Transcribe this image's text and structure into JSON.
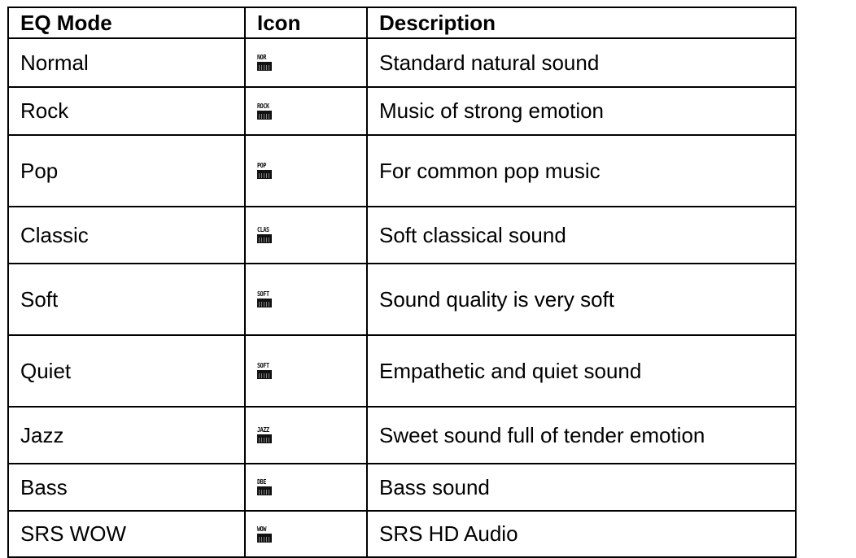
{
  "table": {
    "headers": [
      "EQ Mode",
      "Icon",
      "Description"
    ],
    "rows": [
      {
        "mode": "Normal",
        "icon_text": "NOR",
        "icon": "eq-normal-lcd-icon",
        "description": "Standard natural sound"
      },
      {
        "mode": "Rock",
        "icon_text": "ROCK",
        "icon": "eq-rock-lcd-icon",
        "description": "Music of strong emotion"
      },
      {
        "mode": "Pop",
        "icon_text": "POP",
        "icon": "eq-pop-lcd-icon",
        "description": "For common pop music"
      },
      {
        "mode": "Classic",
        "icon_text": "CLAS",
        "icon": "eq-classic-lcd-icon",
        "description": "Soft classical sound"
      },
      {
        "mode": "Soft",
        "icon_text": "SOFT",
        "icon": "eq-soft-lcd-icon",
        "description": "Sound quality is very soft"
      },
      {
        "mode": "Quiet",
        "icon_text": "SOFT",
        "icon": "eq-quiet-lcd-icon",
        "description": "Empathetic and quiet sound"
      },
      {
        "mode": "Jazz",
        "icon_text": "JAZZ",
        "icon": "eq-jazz-lcd-icon",
        "description": "Sweet sound full of tender emotion"
      },
      {
        "mode": "Bass",
        "icon_text": "DBE",
        "icon": "eq-bass-lcd-icon",
        "description": "Bass sound"
      },
      {
        "mode": "SRS WOW",
        "icon_text": "WOW",
        "icon": "eq-srs-wow-lcd-icon",
        "description": "SRS HD Audio"
      }
    ]
  }
}
